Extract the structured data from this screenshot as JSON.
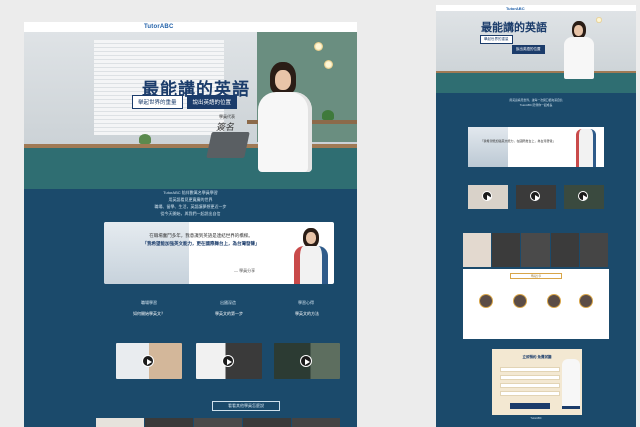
{
  "brand": {
    "logo": "TutorABC",
    "primary": "#1b4a6b",
    "accent": "#1b3c6b",
    "gold": "#d8a548"
  },
  "desktop": {
    "hero": {
      "title": "最能講的英語",
      "tag_left": "舉起世界的重量",
      "tag_right": "說出英語的位置",
      "signature_label": "學員代表",
      "signature": "簽名"
    },
    "intro": [
      "TutorABC 陪伴數萬名學員學習",
      "用英語看見更寬廣的世界",
      "職場、留學、生活，英語讓夢想更近一步",
      "從今天開始，與我們一起說出自信"
    ],
    "quote": {
      "line1": "在職場奮鬥多年，我意識到英語是連結世界的橋樑。",
      "line2": "「我希望能加強英文能力，更在國際舞台上，為台灣發聲」",
      "by": "— 學員分享"
    },
    "section_labels": [
      "職場學習",
      "出國深造",
      "學習心得"
    ],
    "video_titles": [
      "如何開始學英文？",
      "學英文的第一步",
      "學英文的方法"
    ],
    "cta": "看看其他學員怎麼說"
  },
  "mobile": {
    "title": "最能講的英語",
    "tag_left": "舉起世界的重量",
    "tag_right": "說出英語的位置",
    "intro": [
      "用英語看見世界，讓每一次開口都充滿自信",
      "TutorABC 陪伴你一起成長"
    ],
    "quote": "「我希望能加強英文能力，在國際舞台上，為台灣發聲」",
    "panel_pill": "學員分享",
    "form_title": "立即預約 免費試聽",
    "footer": "TutorABC"
  }
}
